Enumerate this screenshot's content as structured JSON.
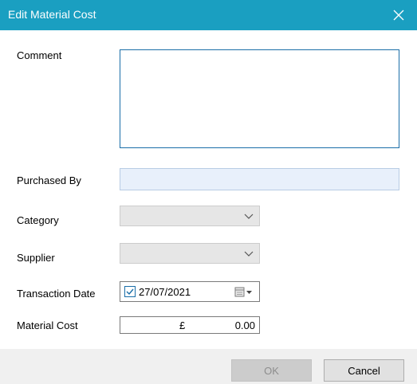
{
  "window": {
    "title": "Edit Material Cost",
    "close_icon": "close-icon"
  },
  "form": {
    "comment": {
      "label": "Comment",
      "value": ""
    },
    "purchased_by": {
      "label": "Purchased By",
      "value": ""
    },
    "category": {
      "label": "Category",
      "value": ""
    },
    "supplier": {
      "label": "Supplier",
      "value": ""
    },
    "transaction_date": {
      "label": "Transaction Date",
      "value": "27/07/2021",
      "checked": true
    },
    "material_cost": {
      "label": "Material Cost",
      "currency": "£",
      "value": "0.00"
    }
  },
  "buttons": {
    "ok": "OK",
    "cancel": "Cancel"
  },
  "colors": {
    "titlebar": "#1a9fc1",
    "accent": "#1a6ea8",
    "footer": "#f0f0f0"
  }
}
